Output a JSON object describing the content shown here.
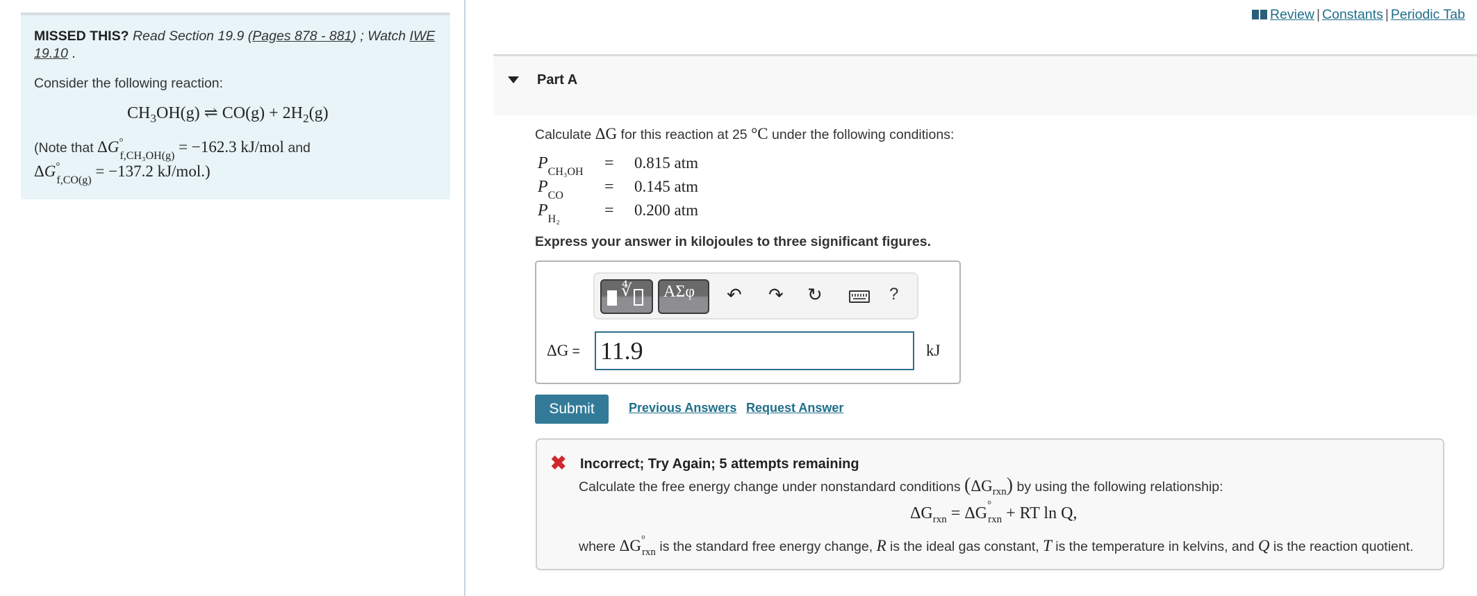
{
  "top_links": {
    "review": "Review",
    "constants": "Constants",
    "periodic_table": "Periodic Tab",
    "separator": "|"
  },
  "missed": {
    "lead": "MISSED THIS?",
    "read": "Read Section 19.9 (",
    "pages_link": "Pages 878 - 881",
    "watch": ") ; Watch ",
    "iwe_link": "IWE 19.10",
    "end": " ."
  },
  "problem": {
    "consider": "Consider the following reaction:",
    "reaction": {
      "reactant": "CH",
      "reactant_sub": "3",
      "reactant_rest": "OH(g)",
      "arrow": "⇌",
      "product1": "CO(g) + 2H",
      "product2_sub": "2",
      "product2_rest": "(g)"
    },
    "note": {
      "open": "(Note that ",
      "dg1_sub": "f,CH₃OH(g)",
      "dg1_value": " = −162.3 kJ/mol",
      "and": " and",
      "dg2_sub": "f,CO(g)",
      "dg2_value": " = −137.2 kJ/mol.)"
    }
  },
  "part_a": {
    "title": "Part A",
    "question_pre": "Calculate ",
    "question_var": "ΔG",
    "question_mid": " for this reaction at 25 ",
    "question_unit": "°C",
    "question_post": " under the following conditions:",
    "pressures": [
      {
        "symbol": "P",
        "sub": "CH₃OH",
        "eq": "=",
        "value": "0.815 atm"
      },
      {
        "symbol": "P",
        "sub": "CO",
        "eq": "=",
        "value": "0.145 atm"
      },
      {
        "symbol": "P",
        "sub": "H₂",
        "eq": "=",
        "value": "0.200 atm"
      }
    ],
    "instruction": "Express your answer in kilojoules to three significant figures.",
    "answer_label_var": "ΔG",
    "answer_label_eq": " =",
    "answer_value": "11.9",
    "unit": "kJ",
    "toolbar": {
      "templates_icon": "templates-root-icon",
      "greek": "ΑΣφ",
      "undo": "↶",
      "redo": "↷",
      "reset": "↻",
      "keyboard": "keyboard-icon",
      "help": "?"
    },
    "submit": "Submit",
    "previous_answers": "Previous Answers",
    "request_answer": "Request Answer"
  },
  "feedback": {
    "status_icon": "✖",
    "title": "Incorrect; Try Again; 5 attempts remaining",
    "line1_pre": "Calculate the free energy change under nonstandard conditions ",
    "line1_var": "ΔG",
    "line1_sub": "rxn",
    "line1_post": " by using the following relationship:",
    "formula": {
      "lhs": "ΔG",
      "lhs_sub": "rxn",
      "eq": " = ",
      "rhs1": "ΔG",
      "rhs1_sup": "°",
      "rhs1_sub": "rxn",
      "rhs2": " + RT ln Q,"
    },
    "line2_pre": "where ",
    "line2_var": "ΔG",
    "line2_sup": "°",
    "line2_sub": "rxn",
    "line2_a": " is the standard free energy change, ",
    "line2_R": "R",
    "line2_b": " is the ideal gas constant, ",
    "line2_T": "T",
    "line2_c": " is the temperature in kelvins, and ",
    "line2_Q": "Q",
    "line2_d": " is the reaction quotient."
  },
  "colors": {
    "accent": "#337a99",
    "link": "#1f6f8b",
    "error": "#d0272c",
    "left_panel_bg": "#e8f4f7"
  }
}
